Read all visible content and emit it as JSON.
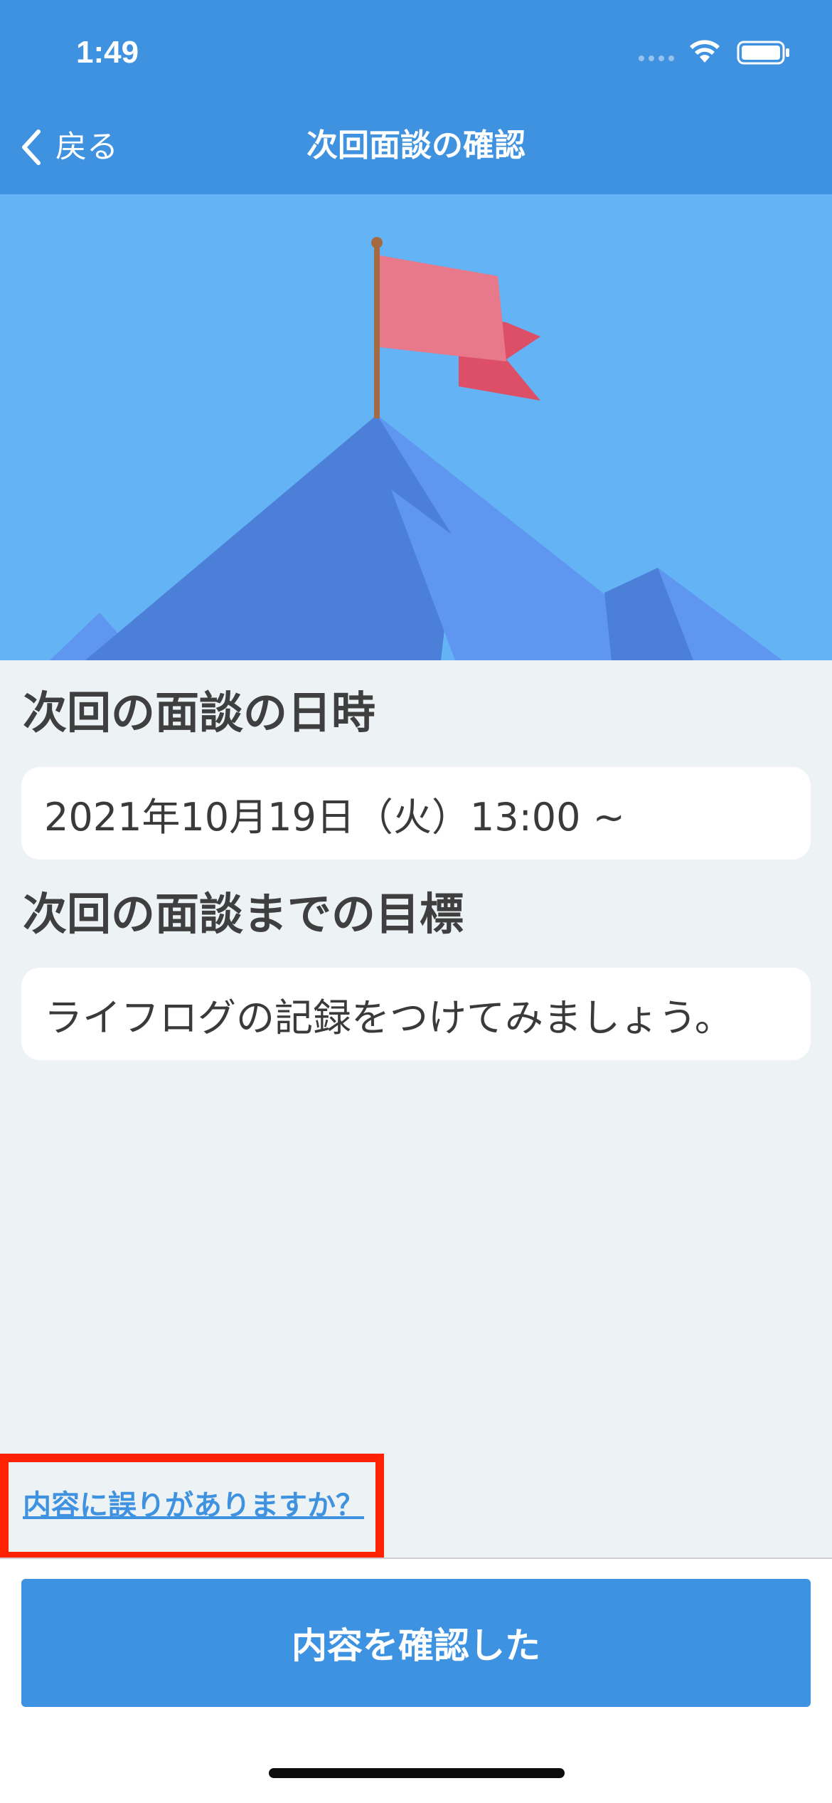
{
  "status_bar": {
    "time": "1:49"
  },
  "nav": {
    "back_label": "戻る",
    "title": "次回面談の確認"
  },
  "sections": {
    "date_title": "次回の面談の日時",
    "date_value": "2021年10月19日（火）13:00 ~",
    "goal_title": "次回の面談までの目標",
    "goal_value": "ライフログの記録をつけてみましょう。"
  },
  "links": {
    "error_link": "内容に誤りがありますか？"
  },
  "footer": {
    "confirm_label": "内容を確認した"
  },
  "colors": {
    "header": "#3f92e0",
    "hero_sky": "#64b3f4",
    "mountain_dark": "#4b7fd8",
    "mountain_light": "#5f96ef",
    "flag": "#e8798a",
    "flag_back": "#dc4f67",
    "highlight": "#ff2200"
  },
  "icons": {
    "back": "chevron-left-icon",
    "wifi": "wifi-icon",
    "battery": "battery-icon",
    "signal": "signal-icon",
    "illustration": "mountain-flag-illustration"
  }
}
